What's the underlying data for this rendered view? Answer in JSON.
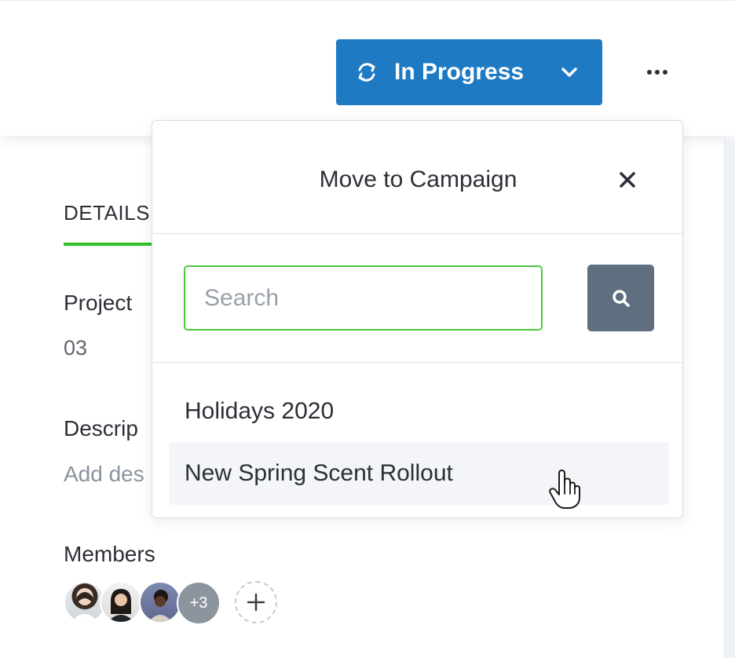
{
  "header": {
    "status_button": {
      "label": "In Progress",
      "icon": "sync-icon",
      "chevron_icon": "chevron-down-icon"
    },
    "more_menu_icon": "more-horizontal-icon"
  },
  "details": {
    "tab_label": "DETAILS",
    "project_label": "Project",
    "project_value": "03",
    "description_label": "Descrip",
    "description_placeholder": "Add des",
    "members_label": "Members",
    "members_more_count": "+3"
  },
  "dropdown": {
    "title": "Move to Campaign",
    "close_icon": "close-icon",
    "search_placeholder": "Search",
    "search_value": "",
    "search_button_icon": "search-icon",
    "items": [
      {
        "label": "Holidays 2020",
        "hovered": false
      },
      {
        "label": "New Spring Scent Rollout",
        "hovered": true
      }
    ]
  },
  "colors": {
    "status_blue": "#1f7ac4",
    "focus_green": "#4cc93d",
    "tab_green": "#2ec227",
    "search_button_slate": "#5f6f80"
  }
}
